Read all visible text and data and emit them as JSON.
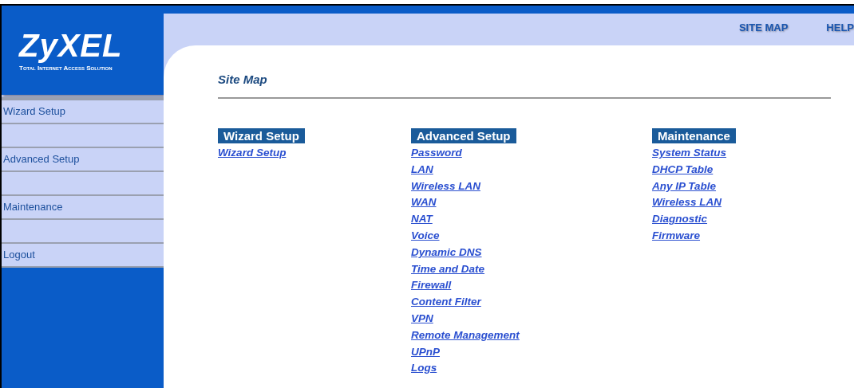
{
  "logo": {
    "brand": "ZyXEL",
    "tagline": "Total Internet Access Solution"
  },
  "top_links": [
    {
      "label": "SITE MAP"
    },
    {
      "label": "HELP"
    }
  ],
  "sidebar": {
    "items": [
      {
        "label": "Wizard Setup"
      },
      {
        "label": "Advanced Setup"
      },
      {
        "label": "Maintenance"
      },
      {
        "label": "Logout"
      }
    ]
  },
  "page_title": "Site Map",
  "sections": [
    {
      "heading": "Wizard Setup",
      "links": [
        "Wizard Setup"
      ]
    },
    {
      "heading": "Advanced Setup",
      "links": [
        "Password",
        "LAN",
        "Wireless LAN",
        "WAN",
        "NAT",
        "Voice",
        "Dynamic DNS",
        "Time and Date",
        "Firewall",
        "Content Filter",
        "VPN",
        "Remote Management",
        "UPnP",
        "Logs"
      ]
    },
    {
      "heading": "Maintenance",
      "links": [
        "System Status",
        "DHCP Table",
        "Any IP Table",
        "Wireless LAN",
        "Diagnostic",
        "Firmware"
      ]
    }
  ]
}
